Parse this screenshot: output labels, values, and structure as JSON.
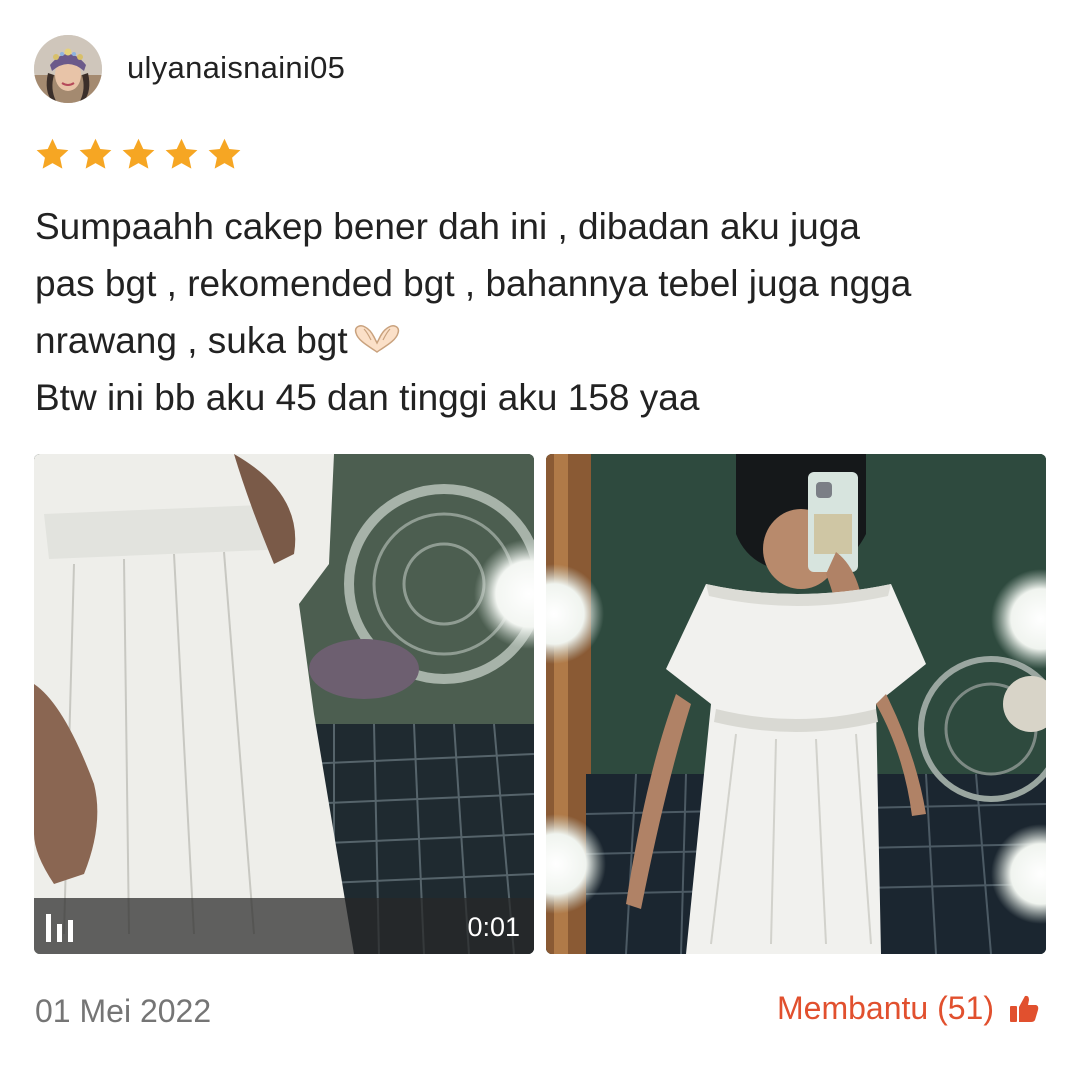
{
  "review": {
    "username": "ulyanaisnaini05",
    "rating": 5,
    "text_lines": [
      "Sumpaahh cakep bener dah ini , dibadan aku juga",
      "pas bgt , rekomended bgt , bahannya tebel juga ngga",
      "nrawang , suka bgt",
      "Btw ini bb aku 45 dan tinggi aku 158 yaa"
    ],
    "emoji": "heart-hands-emoji",
    "media": {
      "video_duration": "0:01",
      "video_icon": "video-bars-icon"
    },
    "date": "01 Mei 2022",
    "helpful_label": "Membantu (51)",
    "helpful_icon": "thumbs-up-icon"
  },
  "colors": {
    "star": "#f6a623",
    "accent": "#e1502e",
    "muted_text": "#757575",
    "body_text": "#222222"
  }
}
